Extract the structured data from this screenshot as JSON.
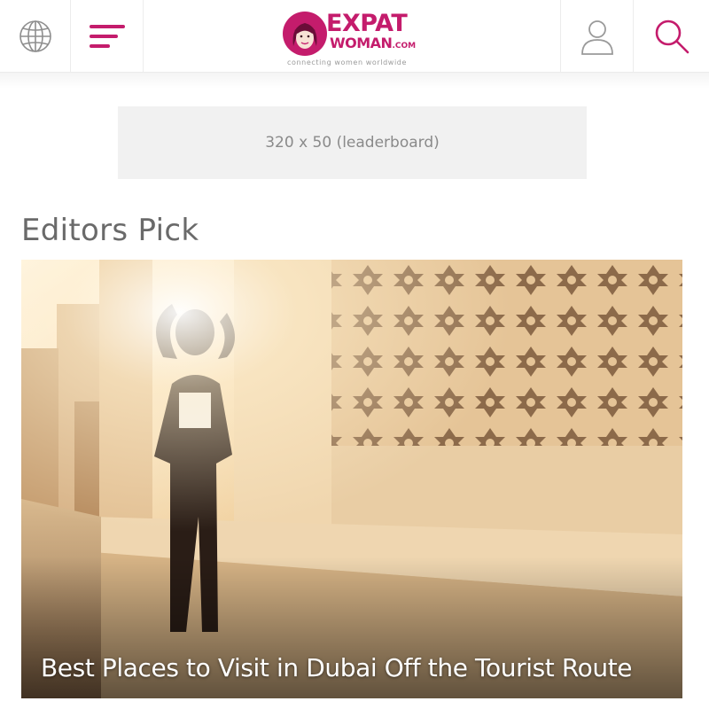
{
  "header": {
    "logo": {
      "line1": "EXPAT",
      "line2": "WOMAN",
      "dotcom": ".COM",
      "tagline": "connecting women worldwide"
    },
    "icons": {
      "language": "globe-icon",
      "menu": "hamburger-menu-icon",
      "account": "user-icon",
      "search": "search-icon"
    },
    "brand_color": "#c41c6c"
  },
  "ad": {
    "label": "320 x 50 (leaderboard)"
  },
  "editors_pick": {
    "title": "Editors Pick",
    "featured": {
      "headline": "Best Places to Visit in Dubai Off the Tourist Route"
    }
  }
}
